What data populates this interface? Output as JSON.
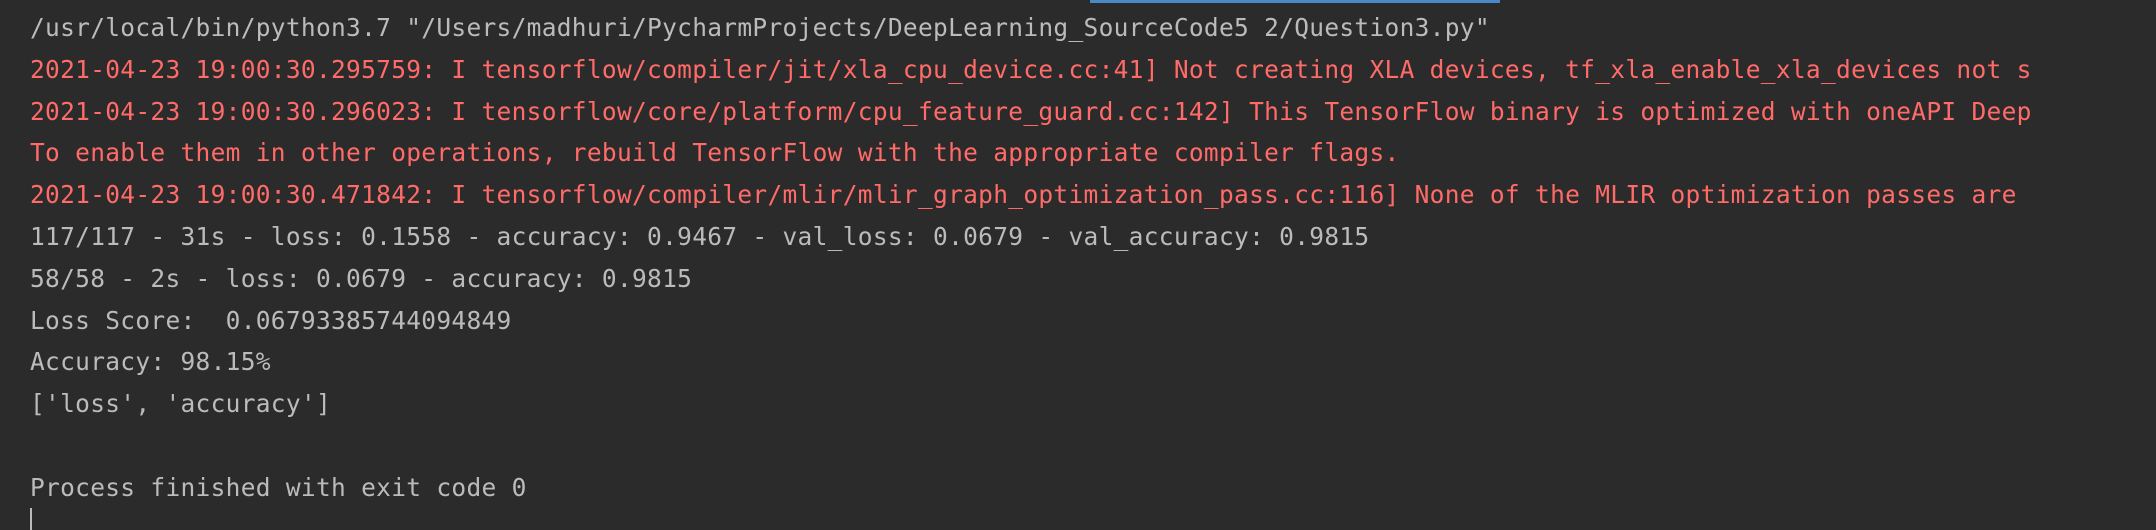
{
  "console": {
    "lines": [
      {
        "type": "normal",
        "text": "/usr/local/bin/python3.7 \"/Users/madhuri/PycharmProjects/DeepLearning_SourceCode5 2/Question3.py\""
      },
      {
        "type": "error",
        "text": "2021-04-23 19:00:30.295759: I tensorflow/compiler/jit/xla_cpu_device.cc:41] Not creating XLA devices, tf_xla_enable_xla_devices not s"
      },
      {
        "type": "error",
        "text": "2021-04-23 19:00:30.296023: I tensorflow/core/platform/cpu_feature_guard.cc:142] This TensorFlow binary is optimized with oneAPI Deep"
      },
      {
        "type": "error",
        "text": "To enable them in other operations, rebuild TensorFlow with the appropriate compiler flags."
      },
      {
        "type": "error",
        "text": "2021-04-23 19:00:30.471842: I tensorflow/compiler/mlir/mlir_graph_optimization_pass.cc:116] None of the MLIR optimization passes are"
      },
      {
        "type": "normal",
        "text": "117/117 - 31s - loss: 0.1558 - accuracy: 0.9467 - val_loss: 0.0679 - val_accuracy: 0.9815"
      },
      {
        "type": "normal",
        "text": "58/58 - 2s - loss: 0.0679 - accuracy: 0.9815"
      },
      {
        "type": "normal",
        "text": "Loss Score:  0.06793385744094849"
      },
      {
        "type": "normal",
        "text": "Accuracy: 98.15%"
      },
      {
        "type": "normal",
        "text": "['loss', 'accuracy']"
      },
      {
        "type": "empty",
        "text": ""
      },
      {
        "type": "normal",
        "text": "Process finished with exit code 0"
      }
    ]
  },
  "colors": {
    "background": "#2b2b2b",
    "normal_text": "#bbbbbb",
    "error_text": "#ff6b68",
    "accent": "#4a88c7"
  }
}
